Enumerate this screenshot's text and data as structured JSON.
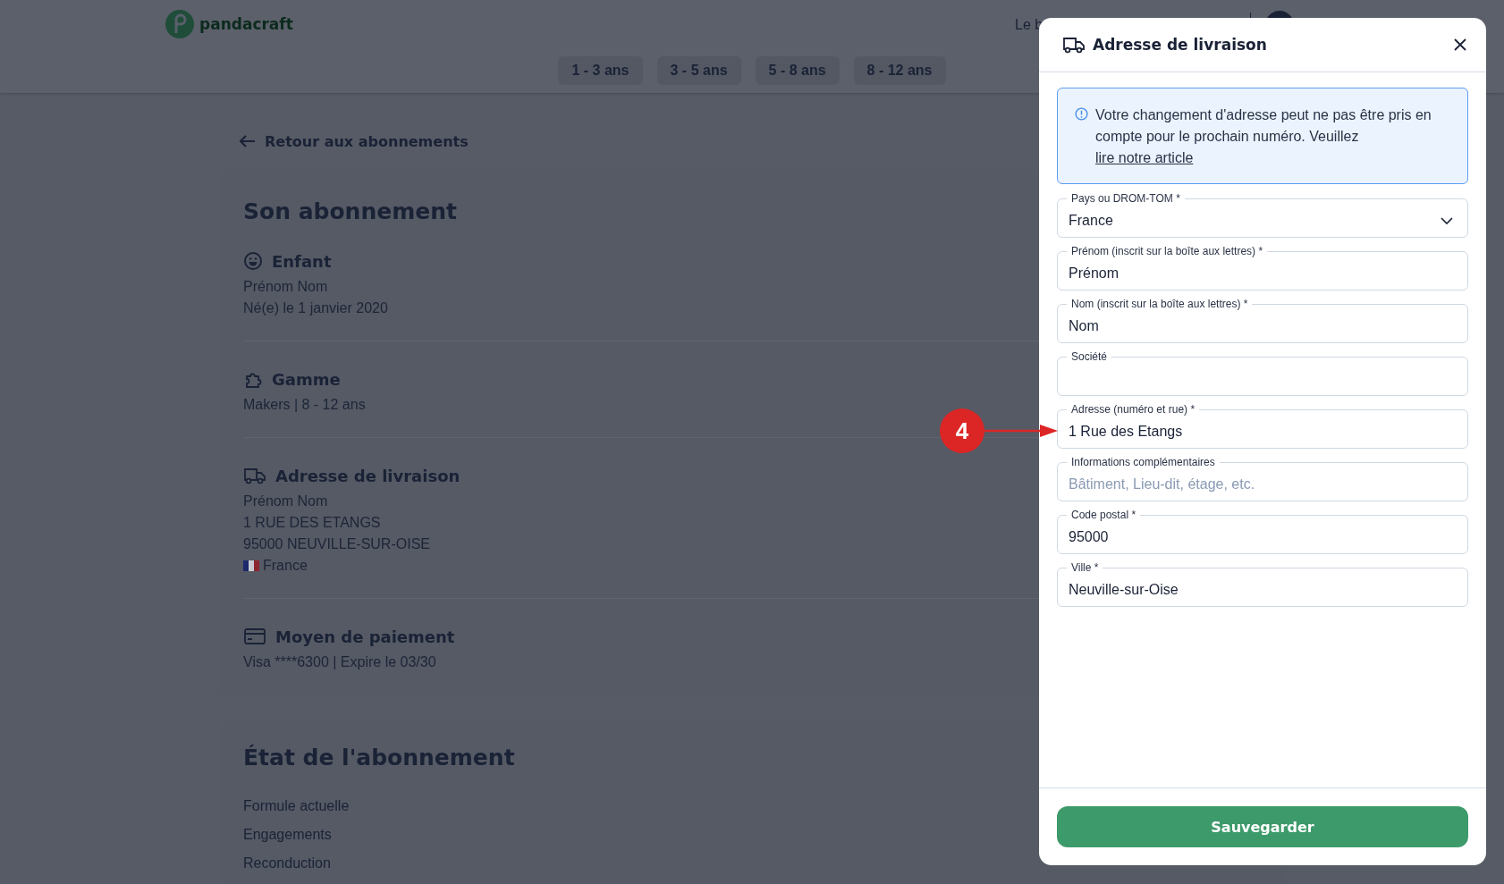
{
  "header": {
    "logo": "pandacraft",
    "age_tabs": [
      "1 - 3 ans",
      "3 - 5 ans",
      "5 - 8 ans",
      "8 - 12 ans"
    ],
    "nav_text": "Le b"
  },
  "back_link": "Retour aux abonnements",
  "subscription": {
    "title": "Son abonnement",
    "sections": [
      {
        "kind": "child",
        "title": "Enfant",
        "lines": [
          "Prénom Nom",
          "Né(e) le 1 janvier 2020"
        ]
      },
      {
        "kind": "range",
        "title": "Gamme",
        "lines": [
          "Makers | 8 - 12 ans"
        ]
      },
      {
        "kind": "address",
        "title": "Adresse de livraison",
        "lines": [
          "Prénom Nom",
          "1 RUE DES ETANGS",
          "95000 NEUVILLE-SUR-OISE"
        ],
        "country": "France"
      },
      {
        "kind": "payment",
        "title": "Moyen de paiement",
        "lines": [
          "Visa ****6300 | Expire le 03/30"
        ]
      }
    ]
  },
  "status": {
    "title": "État de l'abonnement",
    "rows": [
      "Formule actuelle",
      "Engagements",
      "Reconduction"
    ]
  },
  "drawer": {
    "title": "Adresse de livraison",
    "notice": "Votre changement d'adresse peut ne pas être pris en compte pour le prochain numéro. Veuillez",
    "notice_link": "lire notre article",
    "fields": [
      {
        "kind": "select",
        "label": "Pays ou DROM-TOM *",
        "value": "France"
      },
      {
        "kind": "text",
        "label": "Prénom (inscrit sur la boîte aux lettres) *",
        "value": "Prénom"
      },
      {
        "kind": "text",
        "label": "Nom (inscrit sur la boîte aux lettres) *",
        "value": "Nom"
      },
      {
        "kind": "text",
        "label": "Société"
      },
      {
        "kind": "text",
        "label": "Adresse (numéro et rue) *",
        "value": "1 Rue des Etangs"
      },
      {
        "kind": "text",
        "label": "Informations complémentaires",
        "placeholder": "Bâtiment, Lieu-dit, étage, etc."
      },
      {
        "kind": "text",
        "label": "Code postal *",
        "value": "95000"
      },
      {
        "kind": "text",
        "label": "Ville *",
        "value": "Neuville-sur-Oise"
      }
    ],
    "save_button": "Sauvegarder"
  },
  "annotation": {
    "number": "4"
  }
}
